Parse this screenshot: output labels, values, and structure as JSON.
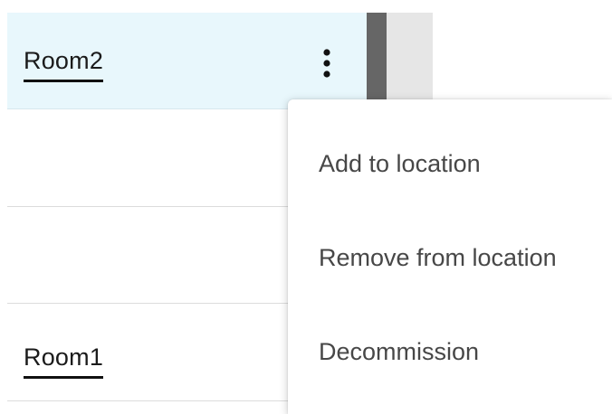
{
  "rows": [
    {
      "label": "Room2",
      "selected": true
    },
    {
      "label": ""
    },
    {
      "label": ""
    },
    {
      "label": "Room1"
    }
  ],
  "row_menu_icon": "more-vertical-icon",
  "context_menu": {
    "items": [
      {
        "label": "Add to location"
      },
      {
        "label": "Remove from location"
      },
      {
        "label": "Decommission"
      }
    ]
  },
  "colors": {
    "selected_row_bg": "#e8f7fc",
    "text_dark": "#1b1b1b",
    "menu_text": "#474747",
    "scroll_thumb": "#666666"
  }
}
